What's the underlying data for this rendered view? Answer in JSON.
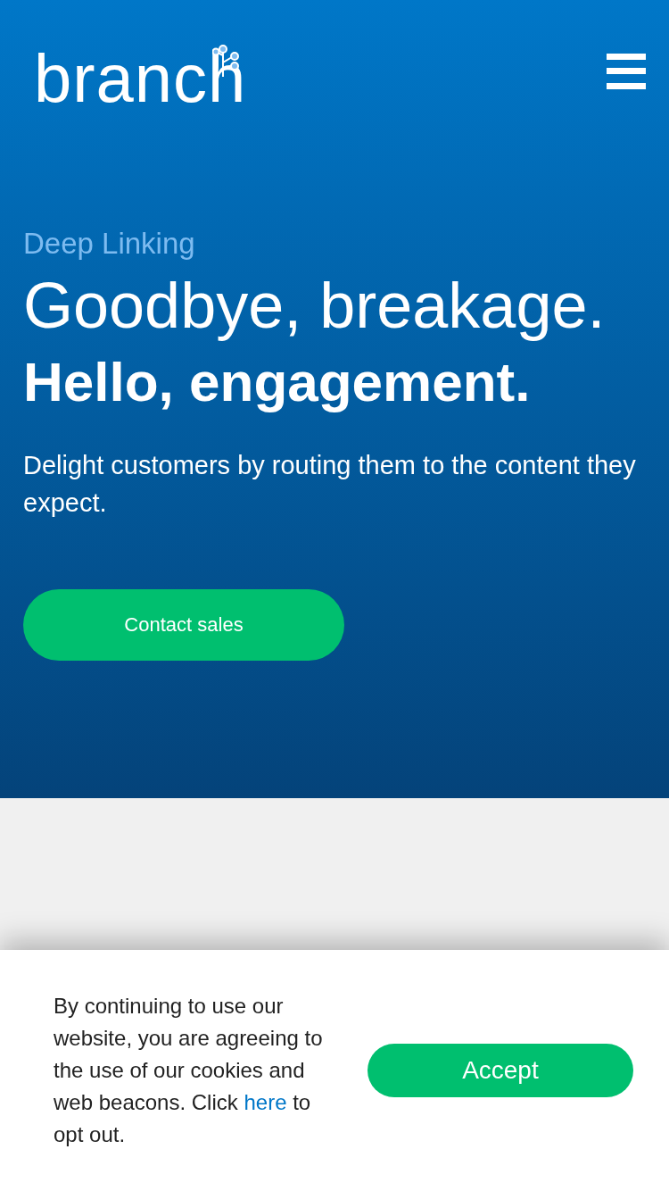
{
  "header": {
    "logo": "branch"
  },
  "hero": {
    "eyebrow": "Deep Linking",
    "headline_light": "Goodbye, breakage.",
    "headline_bold": "Hello, engagement.",
    "description": "Delight customers by routing them to the content they expect.",
    "button": "Contact sales"
  },
  "cookie_banner": {
    "text_before": "By continuing to use our website, you are agreeing to the use of our cookies and web beacons. Click",
    "link": "here",
    "text_after": "to opt out.",
    "button": "Accept"
  }
}
